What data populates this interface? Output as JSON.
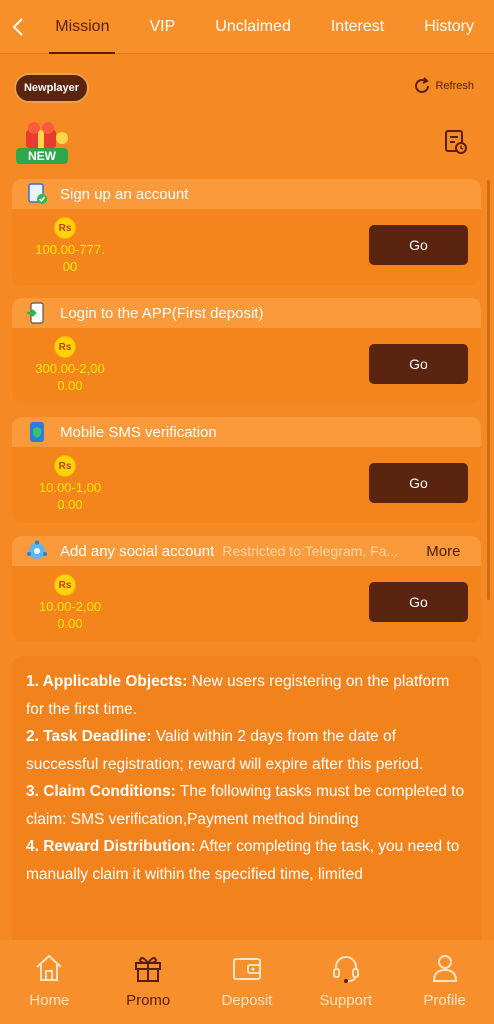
{
  "tabs": [
    "Mission",
    "VIP",
    "Unclaimed",
    "Interest",
    "History"
  ],
  "newplayer_label": "Newplayer",
  "refresh_label": "Refresh",
  "gift_badge": "NEW",
  "currency_symbol": "Rs",
  "tasks": [
    {
      "title": "Sign up an account",
      "reward_line1": "100.00-777.",
      "reward_line2": "00",
      "button": "Go",
      "icon": "document-check-icon"
    },
    {
      "title": "Login to the APP(First deposit)",
      "reward_line1": "300.00-2,00",
      "reward_line2": "0.00",
      "button": "Go",
      "icon": "phone-login-icon"
    },
    {
      "title": "Mobile SMS verification",
      "reward_line1": "10.00-1,00",
      "reward_line2": "0.00",
      "button": "Go",
      "icon": "phone-shield-icon"
    },
    {
      "title": "Add any social account",
      "restriction": "Restricted to:Telegram, Fa...",
      "more": "More",
      "reward_line1": "10.00-2,00",
      "reward_line2": "0.00",
      "button": "Go",
      "icon": "globe-icon"
    }
  ],
  "rules": [
    {
      "label": "1. Applicable Objects:",
      "text": " New users registering on the platform for the first time."
    },
    {
      "label": "2. Task Deadline:",
      "text": " Valid within 2 days from the date of successful registration; reward will expire after this period."
    },
    {
      "label": "3. Claim Conditions:",
      "text": " The following tasks must be completed to claim: SMS verification,Payment method binding"
    },
    {
      "label": "4. Reward Distribution:",
      "text": " After completing the task, you need to manually claim it within the specified time, limited"
    }
  ],
  "nav": [
    "Home",
    "Promo",
    "Deposit",
    "Support",
    "Profile"
  ],
  "colors": {
    "primary": "#f58a25",
    "dark_button": "#5b2410",
    "reward_text": "#ffea00"
  }
}
